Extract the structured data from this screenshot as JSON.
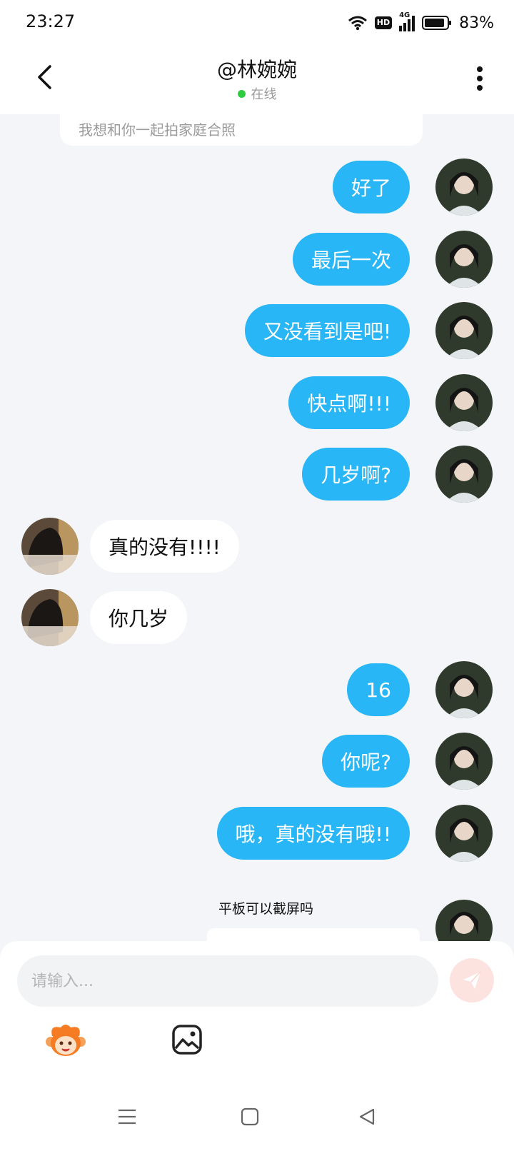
{
  "status": {
    "time": "23:27",
    "network": "4G",
    "hd": "HD",
    "battery": "83%"
  },
  "header": {
    "title": "@林婉婉",
    "presence": "在线"
  },
  "chat": {
    "partial_text": "我想和你一起拍家庭合照",
    "messages": [
      {
        "dir": "out",
        "text": "好了"
      },
      {
        "dir": "out",
        "text": "最后一次"
      },
      {
        "dir": "out",
        "text": "又没看到是吧!"
      },
      {
        "dir": "out",
        "text": "快点啊!!!"
      },
      {
        "dir": "out",
        "text": "几岁啊?"
      },
      {
        "dir": "in",
        "text": "真的没有!!!!"
      },
      {
        "dir": "in",
        "text": "你几岁"
      },
      {
        "dir": "out",
        "text": "16"
      },
      {
        "dir": "out",
        "text": "你呢?"
      },
      {
        "dir": "out",
        "text": "哦，真的没有哦!!"
      }
    ],
    "shared_caption": "平板可以截屏吗"
  },
  "composer": {
    "placeholder": "请输入..."
  },
  "colors": {
    "outgoing_bubble": "#29b6f6",
    "incoming_bubble": "#ffffff",
    "background": "#f3f5f8",
    "send_button": "#fde3e0",
    "online": "#2ecc40"
  }
}
